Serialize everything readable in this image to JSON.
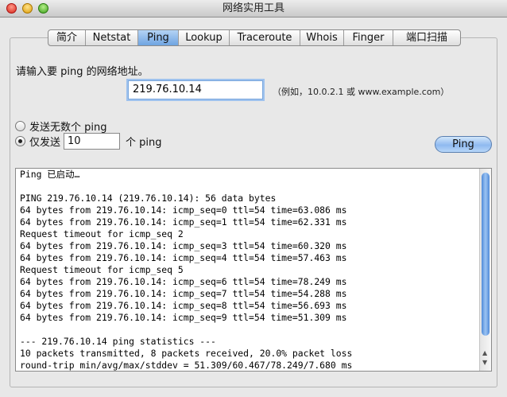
{
  "window": {
    "title": "网络实用工具"
  },
  "tabs": [
    {
      "label": "简介"
    },
    {
      "label": "Netstat"
    },
    {
      "label": "Ping"
    },
    {
      "label": "Lookup"
    },
    {
      "label": "Traceroute"
    },
    {
      "label": "Whois"
    },
    {
      "label": "Finger"
    },
    {
      "label": "端口扫描"
    }
  ],
  "active_tab": "Ping",
  "form": {
    "prompt": "请输入要 ping 的网络地址。",
    "address_value": "219.76.10.14",
    "address_hint": "（例如，10.0.2.1 或 www.example.com）",
    "radio_unlimited_label": "发送无数个 ping",
    "radio_limited_prefix": "仅发送",
    "count_value": "10",
    "radio_limited_suffix": "个 ping",
    "ping_button_label": "Ping"
  },
  "output": {
    "lines": [
      "Ping 已启动…",
      "",
      "PING 219.76.10.14 (219.76.10.14): 56 data bytes",
      "64 bytes from 219.76.10.14: icmp_seq=0 ttl=54 time=63.086 ms",
      "64 bytes from 219.76.10.14: icmp_seq=1 ttl=54 time=62.331 ms",
      "Request timeout for icmp_seq 2",
      "64 bytes from 219.76.10.14: icmp_seq=3 ttl=54 time=60.320 ms",
      "64 bytes from 219.76.10.14: icmp_seq=4 ttl=54 time=57.463 ms",
      "Request timeout for icmp_seq 5",
      "64 bytes from 219.76.10.14: icmp_seq=6 ttl=54 time=78.249 ms",
      "64 bytes from 219.76.10.14: icmp_seq=7 ttl=54 time=54.288 ms",
      "64 bytes from 219.76.10.14: icmp_seq=8 ttl=54 time=56.693 ms",
      "64 bytes from 219.76.10.14: icmp_seq=9 ttl=54 time=51.309 ms",
      "",
      "--- 219.76.10.14 ping statistics ---",
      "10 packets transmitted, 8 packets received, 20.0% packet loss",
      "round-trip min/avg/max/stddev = 51.309/60.467/78.249/7.680 ms"
    ]
  },
  "icons": {
    "close": "close-icon",
    "minimize": "minimize-icon",
    "zoom": "zoom-icon",
    "scroll_up": "scroll-up-arrow-icon",
    "scroll_down": "scroll-down-arrow-icon"
  },
  "colors": {
    "accent": "#6fa4e1",
    "focus_ring": "#9ec2ee"
  }
}
